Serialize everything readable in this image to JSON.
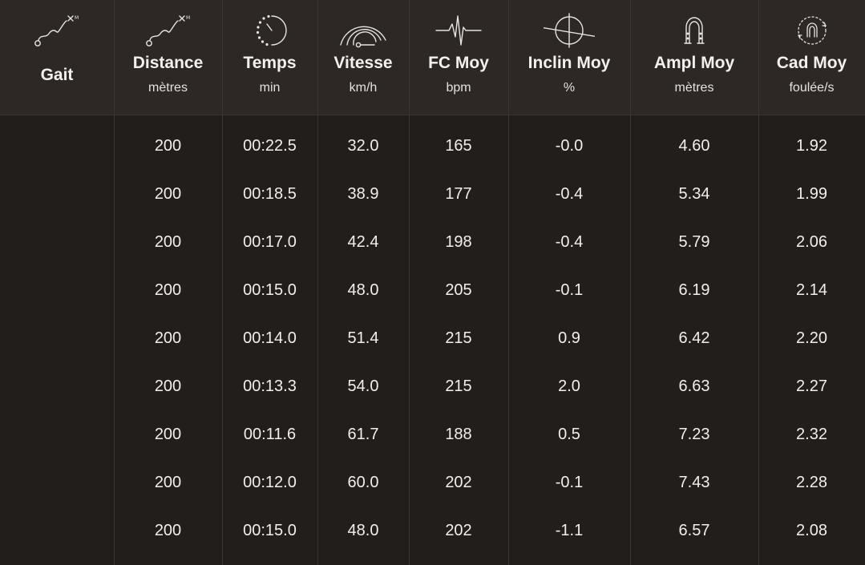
{
  "columns": [
    {
      "key": "gait",
      "label": "Gait",
      "unit": "",
      "icon": "route-icon"
    },
    {
      "key": "distance",
      "label": "Distance",
      "unit": "mètres",
      "icon": "route-icon"
    },
    {
      "key": "temps",
      "label": "Temps",
      "unit": "min",
      "icon": "stopwatch-icon"
    },
    {
      "key": "vitesse",
      "label": "Vitesse",
      "unit": "km/h",
      "icon": "speedometer-icon"
    },
    {
      "key": "fc",
      "label": "FC Moy",
      "unit": "bpm",
      "icon": "heart-rate-icon"
    },
    {
      "key": "inclin",
      "label": "Inclin Moy",
      "unit": "%",
      "icon": "inclination-icon"
    },
    {
      "key": "ampl",
      "label": "Ampl Moy",
      "unit": "mètres",
      "icon": "horseshoe-icon"
    },
    {
      "key": "cad",
      "label": "Cad Moy",
      "unit": "foulée/s",
      "icon": "cadence-icon"
    }
  ],
  "rows": [
    {
      "gait": "",
      "distance": "200",
      "temps": "00:22.5",
      "vitesse": "32.0",
      "fc": "165",
      "inclin": "-0.0",
      "ampl": "4.60",
      "cad": "1.92"
    },
    {
      "gait": "",
      "distance": "200",
      "temps": "00:18.5",
      "vitesse": "38.9",
      "fc": "177",
      "inclin": "-0.4",
      "ampl": "5.34",
      "cad": "1.99"
    },
    {
      "gait": "",
      "distance": "200",
      "temps": "00:17.0",
      "vitesse": "42.4",
      "fc": "198",
      "inclin": "-0.4",
      "ampl": "5.79",
      "cad": "2.06"
    },
    {
      "gait": "",
      "distance": "200",
      "temps": "00:15.0",
      "vitesse": "48.0",
      "fc": "205",
      "inclin": "-0.1",
      "ampl": "6.19",
      "cad": "2.14"
    },
    {
      "gait": "",
      "distance": "200",
      "temps": "00:14.0",
      "vitesse": "51.4",
      "fc": "215",
      "inclin": "0.9",
      "ampl": "6.42",
      "cad": "2.20"
    },
    {
      "gait": "",
      "distance": "200",
      "temps": "00:13.3",
      "vitesse": "54.0",
      "fc": "215",
      "inclin": "2.0",
      "ampl": "6.63",
      "cad": "2.27"
    },
    {
      "gait": "",
      "distance": "200",
      "temps": "00:11.6",
      "vitesse": "61.7",
      "fc": "188",
      "inclin": "0.5",
      "ampl": "7.23",
      "cad": "2.32"
    },
    {
      "gait": "",
      "distance": "200",
      "temps": "00:12.0",
      "vitesse": "60.0",
      "fc": "202",
      "inclin": "-0.1",
      "ampl": "7.43",
      "cad": "2.28"
    },
    {
      "gait": "",
      "distance": "200",
      "temps": "00:15.0",
      "vitesse": "48.0",
      "fc": "202",
      "inclin": "-1.1",
      "ampl": "6.57",
      "cad": "2.08"
    }
  ],
  "colors": {
    "background": "#221e1b",
    "header_background": "#2d2825",
    "separator": "#3c3632",
    "text": "#f2efe9",
    "icon_stroke": "#e8e4de"
  }
}
